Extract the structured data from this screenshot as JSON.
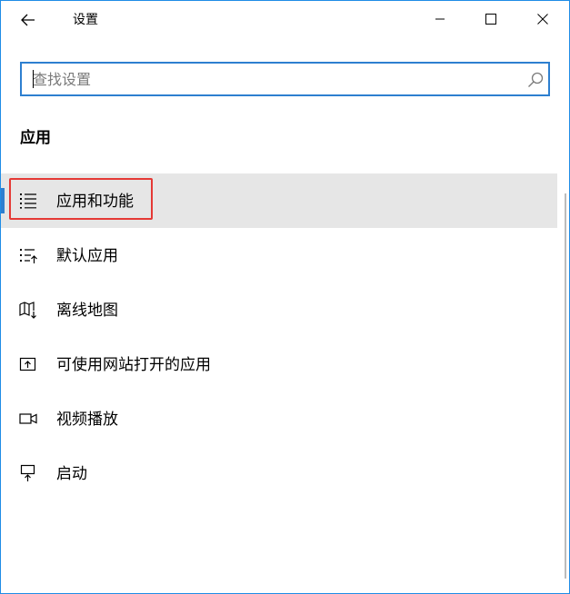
{
  "window": {
    "title": "设置"
  },
  "search": {
    "placeholder": "查找设置",
    "value": ""
  },
  "section": {
    "title": "应用"
  },
  "nav": {
    "items": [
      {
        "label": "应用和功能",
        "icon": "apps-features-icon",
        "selected": true
      },
      {
        "label": "默认应用",
        "icon": "default-apps-icon",
        "selected": false
      },
      {
        "label": "离线地图",
        "icon": "offline-maps-icon",
        "selected": false
      },
      {
        "label": "可使用网站打开的应用",
        "icon": "apps-for-websites-icon",
        "selected": false
      },
      {
        "label": "视频播放",
        "icon": "video-playback-icon",
        "selected": false
      },
      {
        "label": "启动",
        "icon": "startup-icon",
        "selected": false
      }
    ]
  },
  "colors": {
    "accent": "#2d7fd0",
    "selected_bg": "#e6e6e6",
    "highlight": "#e53935",
    "window_border": "#1f8ce6"
  }
}
